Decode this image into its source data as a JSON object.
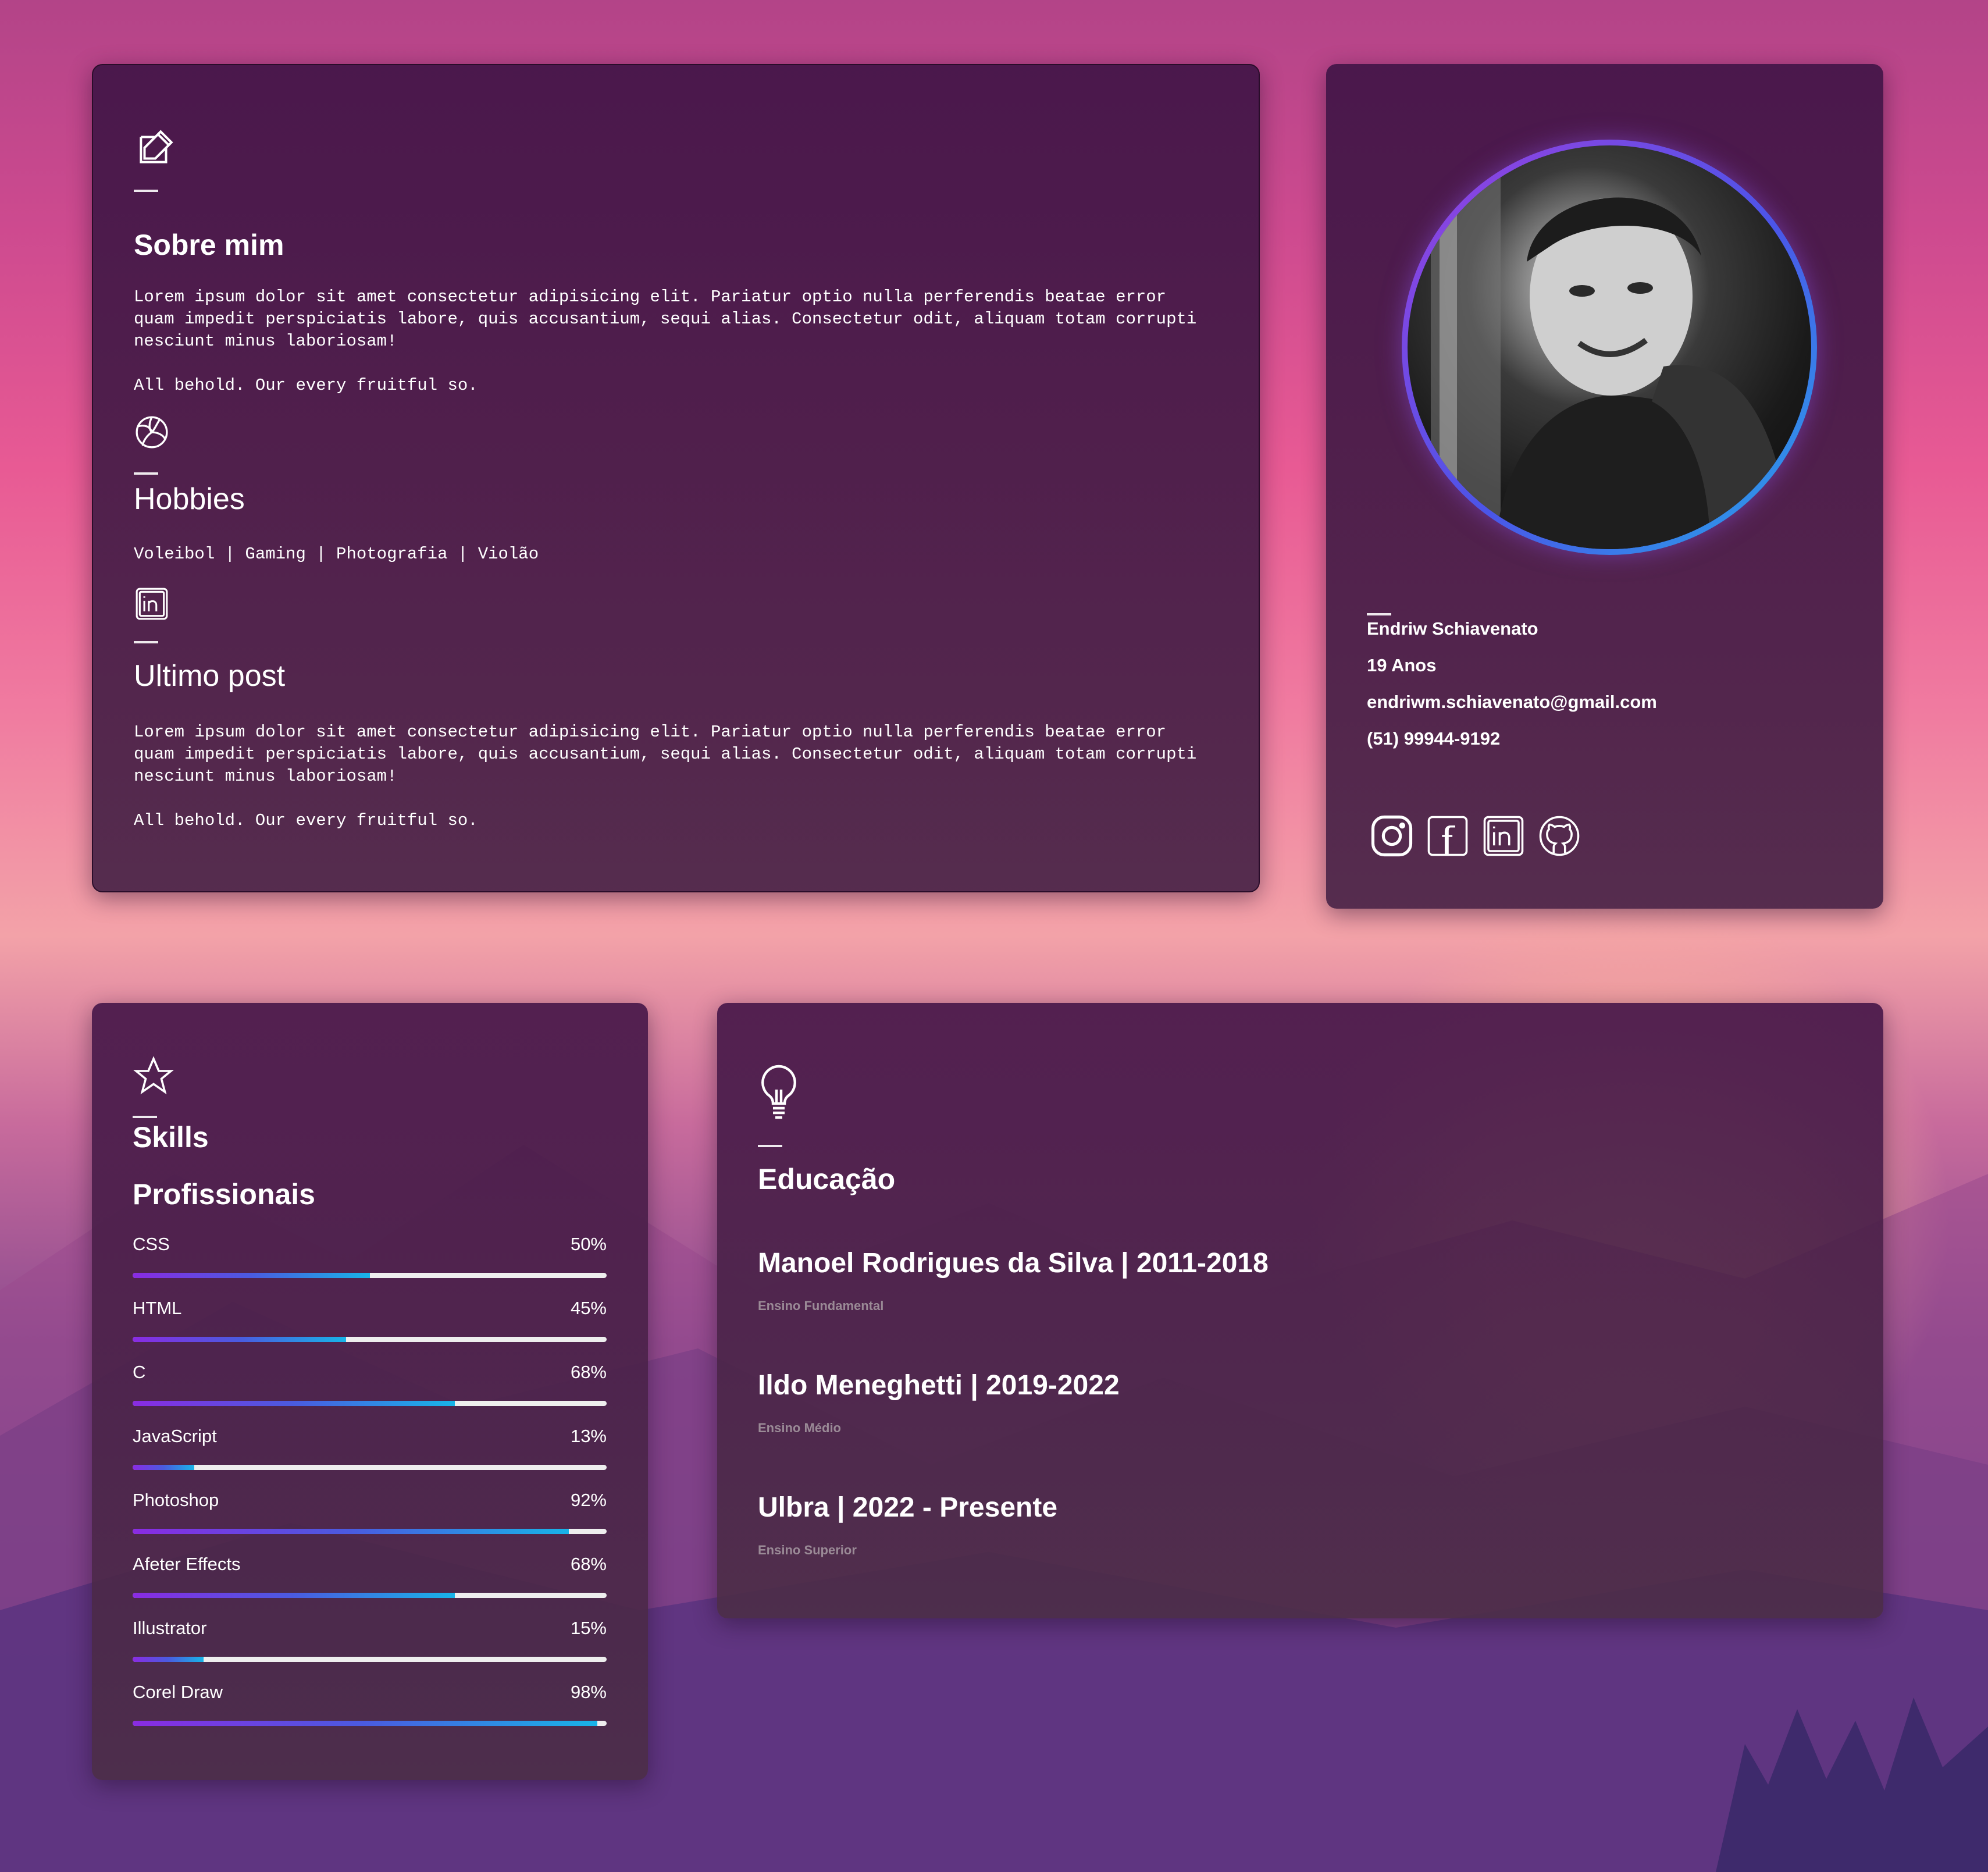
{
  "about": {
    "title": "Sobre mim",
    "paragraph1": "Lorem ipsum dolor sit amet consectetur adipisicing elit. Pariatur optio nulla perferendis beatae error quam impedit perspiciatis labore, quis accusantium, sequi alias. Consectetur odit, aliquam totam corrupti nesciunt minus laboriosam!",
    "paragraph2": "All behold. Our every fruitful so."
  },
  "hobbies": {
    "title": "Hobbies",
    "list": "Voleibol | Gaming | Photografia | Violão"
  },
  "last_post": {
    "title": "Ultimo post",
    "paragraph1": "Lorem ipsum dolor sit amet consectetur adipisicing elit. Pariatur optio nulla perferendis beatae error quam impedit perspiciatis labore, quis accusantium, sequi alias. Consectetur odit, aliquam totam corrupti nesciunt minus laboriosam!",
    "paragraph2": "All behold. Our every fruitful so."
  },
  "profile": {
    "name": "Endriw Schiavenato",
    "age": "19 Anos",
    "email": "endriwm.schiavenato@gmail.com",
    "phone": "(51) 99944-9192",
    "social": [
      "instagram-icon",
      "facebook-icon",
      "linkedin-icon",
      "github-icon"
    ]
  },
  "skills": {
    "title_line1": "Skills",
    "title_line2": "Profissionais",
    "items": [
      {
        "name": "CSS",
        "percent_label": "50%",
        "percent": 50
      },
      {
        "name": "HTML",
        "percent_label": "45%",
        "percent": 45
      },
      {
        "name": "C",
        "percent_label": "68%",
        "percent": 68
      },
      {
        "name": "JavaScript",
        "percent_label": "13%",
        "percent": 13
      },
      {
        "name": "Photoshop",
        "percent_label": "92%",
        "percent": 92
      },
      {
        "name": "Afeter Effects",
        "percent_label": "68%",
        "percent": 68
      },
      {
        "name": "Illustrator",
        "percent_label": "15%",
        "percent": 15
      },
      {
        "name": "Corel Draw",
        "percent_label": "98%",
        "percent": 98
      }
    ]
  },
  "education": {
    "title": "Educação",
    "items": [
      {
        "school": "Manoel Rodrigues da Silva | 2011-2018",
        "level": "Ensino Fundamental"
      },
      {
        "school": "Ildo Meneghetti | 2019-2022",
        "level": "Ensino Médio"
      },
      {
        "school": "Ulbra | 2022 - Presente",
        "level": "Ensino Superior"
      }
    ]
  },
  "colors": {
    "bar_gradient_start": "#8a2be2",
    "bar_gradient_end": "#18b4e8",
    "card_bg": "#4a1c4a"
  }
}
